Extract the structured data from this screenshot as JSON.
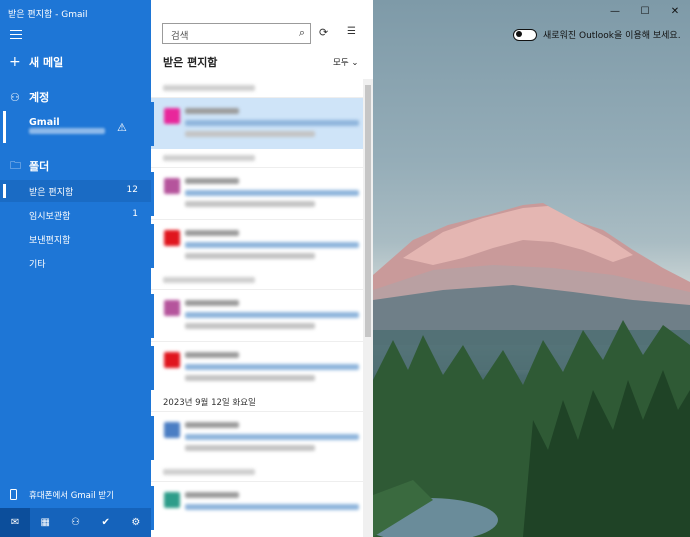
{
  "window": {
    "title": "받은 편지함 - Gmail"
  },
  "sidebar": {
    "new_mail": "새 메일",
    "accounts_header": "계정",
    "account": {
      "name": "Gmail",
      "email": ""
    },
    "folders_header": "폴더",
    "folders": [
      {
        "label": "받은 편지함",
        "count": "12",
        "selected": true
      },
      {
        "label": "임시보관함",
        "count": "1",
        "selected": false
      },
      {
        "label": "보낸편지함",
        "count": "",
        "selected": false
      },
      {
        "label": "기타",
        "count": "",
        "selected": false
      }
    ],
    "get_gmail_phone": "휴대폰에서 Gmail 받기"
  },
  "list": {
    "search_placeholder": "검색",
    "title": "받은 편지함",
    "filter": "모두",
    "date_header": "2023년 9월 12일 화요일"
  },
  "right": {
    "toggle_label": "새로워진 Outlook을 이용해 보세요.",
    "toggle_on": false
  },
  "colors": {
    "sidebar_bg": "#1e76d6",
    "accent": "#1e76d6",
    "selected_item_bg": "#cfe4f8"
  },
  "avatar_colors": [
    "#e8279b",
    "#b5549c",
    "#e0161e",
    "#b5549c",
    "#e0161e",
    "#4b7ec4",
    "#2e9d8a"
  ]
}
